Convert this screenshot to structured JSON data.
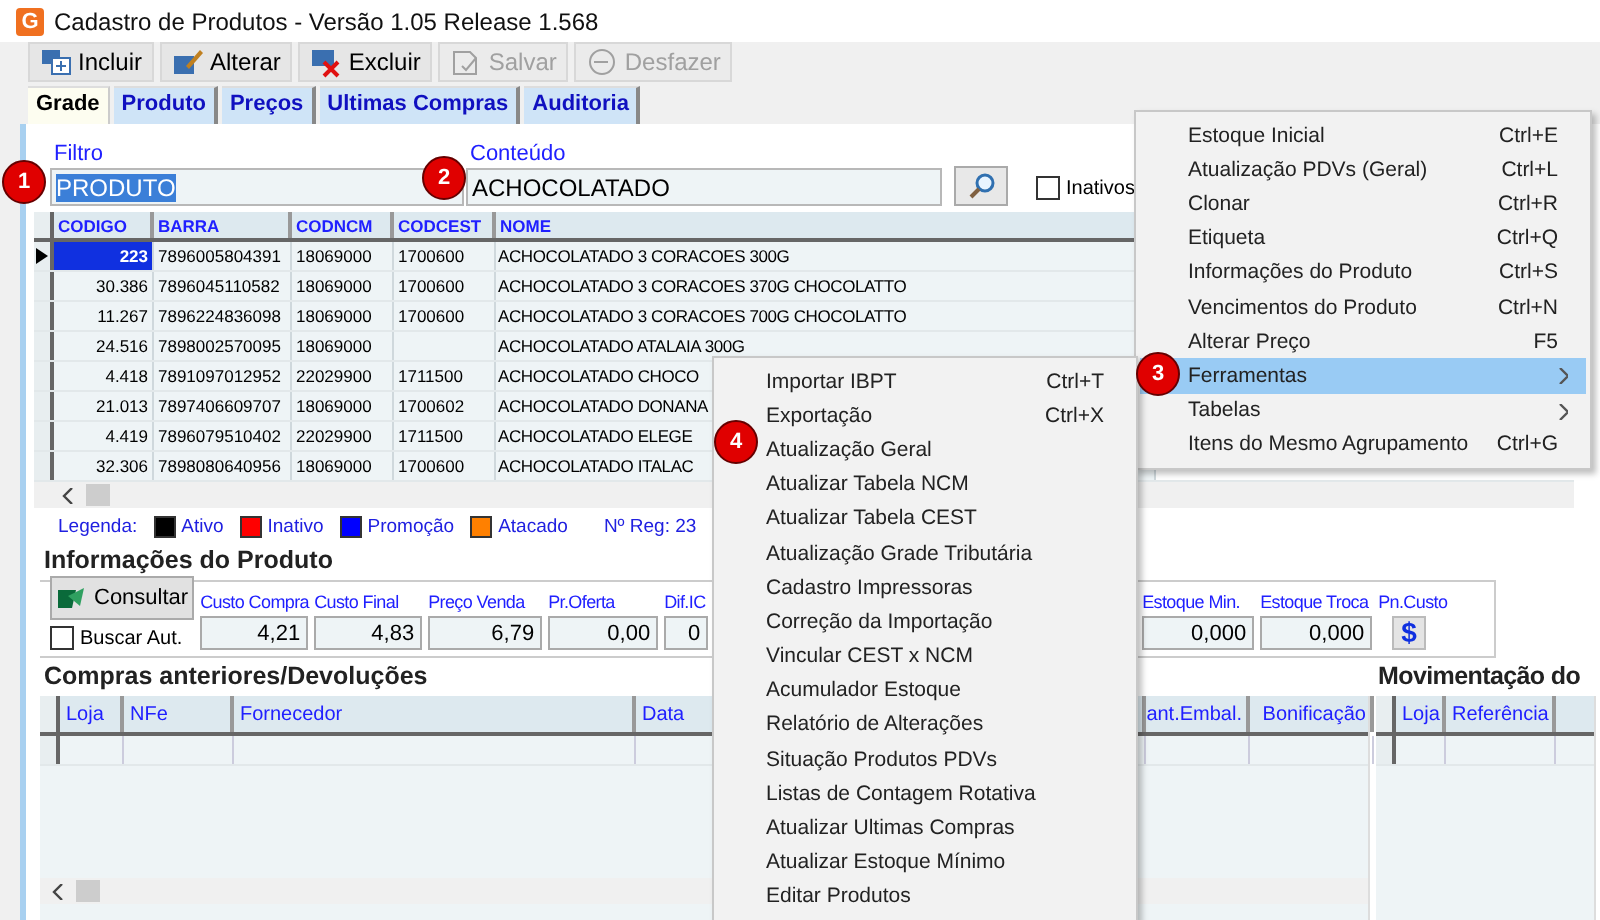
{
  "window": {
    "app_icon": "G",
    "title": "Cadastro de Produtos - Versão 1.05 Release 1.568"
  },
  "toolbar": [
    {
      "label": "Incluir",
      "disabled": false
    },
    {
      "label": "Alterar",
      "disabled": false
    },
    {
      "label": "Excluir",
      "disabled": false
    },
    {
      "label": "Salvar",
      "disabled": true
    },
    {
      "label": "Desfazer",
      "disabled": true
    }
  ],
  "tabs": [
    {
      "label": "Grade",
      "selected": true
    },
    {
      "label": "Produto",
      "selected": false
    },
    {
      "label": "Preços",
      "selected": false
    },
    {
      "label": "Ultimas Compras",
      "selected": false
    },
    {
      "label": "Auditoria",
      "selected": false
    }
  ],
  "filter": {
    "label": "Filtro",
    "value": "PRODUTO"
  },
  "content": {
    "label": "Conteúdo",
    "value": "ACHOCOLATADO"
  },
  "inactive": {
    "label": "Inativos",
    "checked": false
  },
  "grid": {
    "columns": [
      "CODIGO",
      "BARRA",
      "CODNCM",
      "CODCEST",
      "NOME"
    ],
    "rows": [
      {
        "selected": true,
        "cells": [
          "223",
          "7896005804391",
          "18069000",
          "1700600",
          "ACHOCOLATADO 3 CORACOES 300G"
        ]
      },
      {
        "selected": false,
        "cells": [
          "30.386",
          "7896045110582",
          "18069000",
          "1700600",
          "ACHOCOLATADO 3 CORACOES 370G CHOCOLATTO"
        ]
      },
      {
        "selected": false,
        "cells": [
          "11.267",
          "7896224836098",
          "18069000",
          "1700600",
          "ACHOCOLATADO 3 CORACOES 700G CHOCOLATTO"
        ]
      },
      {
        "selected": false,
        "cells": [
          "24.516",
          "7898002570095",
          "18069000",
          null,
          "ACHOCOLATADO ATALAIA 300G"
        ]
      },
      {
        "selected": false,
        "cells": [
          "4.418",
          "7891097012952",
          "22029900",
          "1711500",
          "ACHOCOLATADO CHOCO"
        ]
      },
      {
        "selected": false,
        "cells": [
          "21.013",
          "7897406609707",
          "18069000",
          "1700602",
          "ACHOCOLATADO DONANA"
        ]
      },
      {
        "selected": false,
        "cells": [
          "4.419",
          "7896079510402",
          "22029900",
          "1711500",
          "ACHOCOLATADO ELEGE"
        ]
      },
      {
        "selected": false,
        "cells": [
          "32.306",
          "7898080640956",
          "18069000",
          "1700600",
          "ACHOCOLATADO ITALAC"
        ]
      }
    ]
  },
  "legend": {
    "label": "Legenda:",
    "items": [
      {
        "label": "Ativo",
        "color": "#000000"
      },
      {
        "label": "Inativo",
        "color": "#ff0000"
      },
      {
        "label": "Promoção",
        "color": "#0000ff"
      },
      {
        "label": "Atacado",
        "color": "#ff8000"
      }
    ],
    "count": "Nº Reg: 23"
  },
  "product_info": {
    "title": "Informações do Produto",
    "consult_button": "Consultar",
    "auto_search": {
      "label": "Buscar Aut.",
      "checked": false
    },
    "fields": [
      {
        "label": "Custo Compra",
        "value": "4,21"
      },
      {
        "label": "Custo Final",
        "value": "4,83"
      },
      {
        "label": "Preço Venda",
        "value": "6,79"
      },
      {
        "label": "Pr.Oferta",
        "value": "0,00"
      },
      {
        "label": "Dif.IC",
        "value": "0"
      }
    ],
    "fields_right": [
      {
        "label": "Estoque Min.",
        "value": "0,000"
      },
      {
        "label": "Estoque Troca",
        "value": "0,000"
      }
    ],
    "cost_button": {
      "label": "Pn.Custo",
      "symbol": "$"
    }
  },
  "purchases": {
    "title": "Compras anteriores/Devoluções",
    "columns": [
      "Loja",
      "NFe",
      "Fornecedor",
      "Data",
      "ant.Embal.",
      "Bonificação"
    ]
  },
  "movement": {
    "title": "Movimentação do",
    "columns": [
      "Loja",
      "Referência"
    ]
  },
  "context_menu": {
    "items": [
      {
        "label": "Estoque Inicial",
        "shortcut": "Ctrl+E",
        "submenu": false,
        "selected": false
      },
      {
        "label": "Atualização PDVs (Geral)",
        "shortcut": "Ctrl+L",
        "submenu": false,
        "selected": false
      },
      {
        "label": "Clonar",
        "shortcut": "Ctrl+R",
        "submenu": false,
        "selected": false
      },
      {
        "label": "Etiqueta",
        "shortcut": "Ctrl+Q",
        "submenu": false,
        "selected": false
      },
      {
        "label": "Informações do Produto",
        "shortcut": "Ctrl+S",
        "submenu": false,
        "selected": false
      },
      {
        "label": "Vencimentos do Produto",
        "shortcut": "Ctrl+N",
        "submenu": false,
        "selected": false
      },
      {
        "label": "Alterar Preço",
        "shortcut": "F5",
        "submenu": false,
        "selected": false
      },
      {
        "label": "Ferramentas",
        "submenu": true,
        "selected": true
      },
      {
        "label": "Tabelas",
        "submenu": true,
        "selected": false
      },
      {
        "label": "Itens do Mesmo  Agrupamento",
        "shortcut": "Ctrl+G",
        "submenu": false,
        "selected": false
      }
    ]
  },
  "submenu": {
    "items": [
      {
        "label": "Importar IBPT",
        "shortcut": "Ctrl+T",
        "selected": false
      },
      {
        "label": "Exportação",
        "shortcut": "Ctrl+X",
        "selected": false
      },
      {
        "label": "Atualização Geral",
        "selected": false
      },
      {
        "label": "Atualizar Tabela NCM",
        "selected": false
      },
      {
        "label": "Atualizar Tabela CEST",
        "selected": false
      },
      {
        "label": "Atualização Grade Tributária",
        "selected": false
      },
      {
        "label": "Cadastro Impressoras",
        "selected": false
      },
      {
        "label": "Correção da Importação",
        "selected": false
      },
      {
        "label": "Vincular CEST x NCM",
        "selected": false
      },
      {
        "label": "Acumulador Estoque",
        "selected": false
      },
      {
        "label": "Relatório de Alterações",
        "selected": false
      },
      {
        "label": "Situação Produtos PDVs",
        "selected": false
      },
      {
        "label": "Listas de Contagem Rotativa",
        "selected": false
      },
      {
        "label": "Atualizar Ultimas Compras",
        "selected": false
      },
      {
        "label": "Atualizar Estoque Mínimo",
        "selected": false
      },
      {
        "label": "Editar Produtos",
        "selected": false
      }
    ]
  },
  "callouts": [
    "1",
    "2",
    "3",
    "4"
  ]
}
